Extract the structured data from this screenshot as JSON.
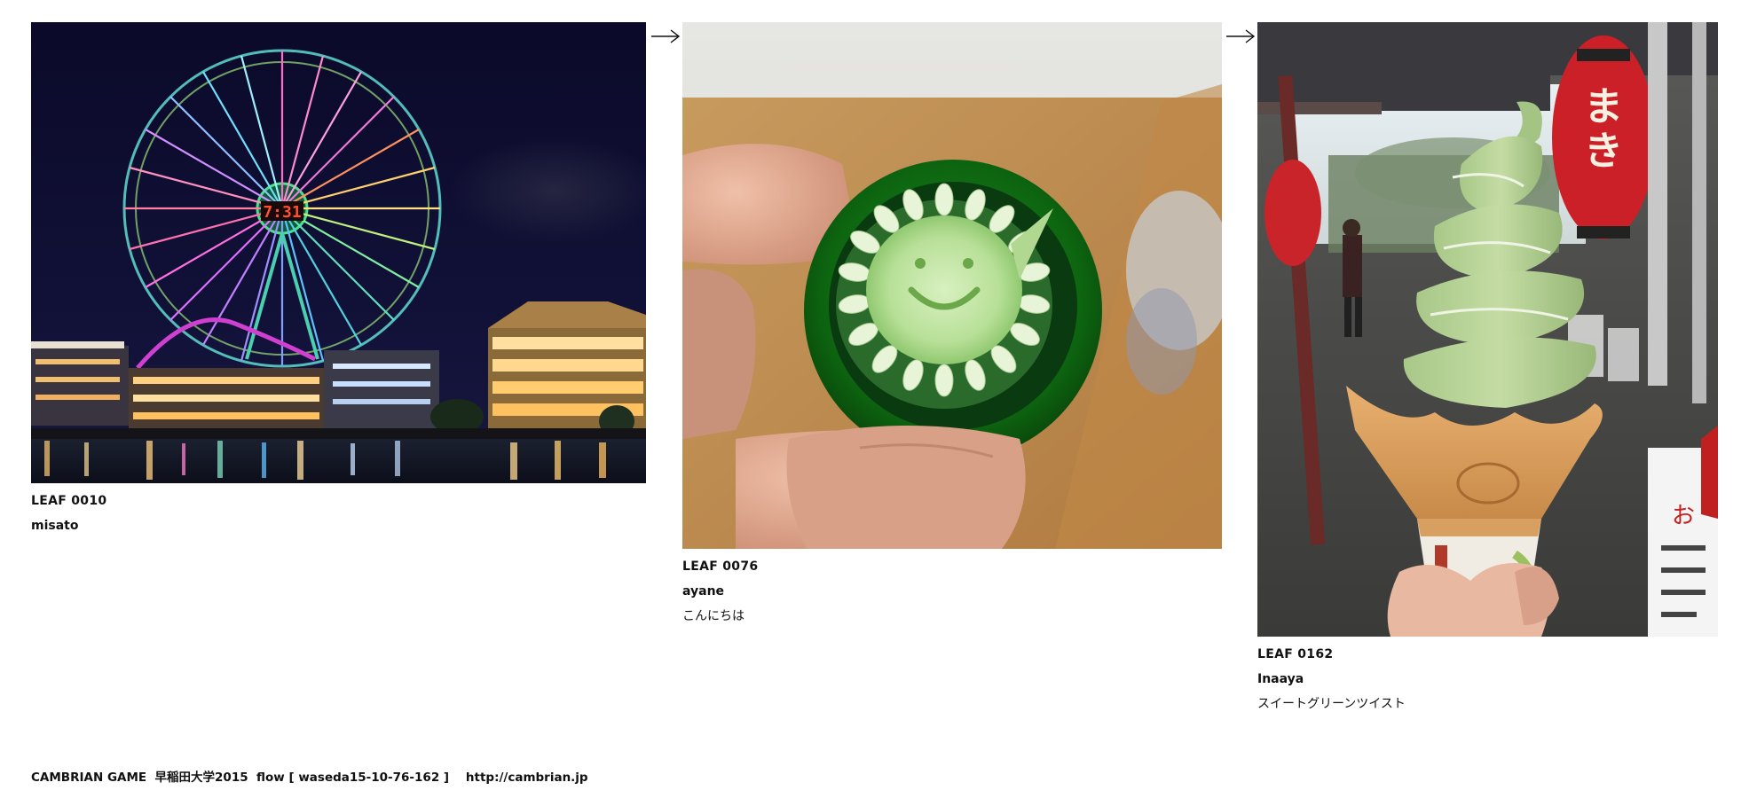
{
  "leaves": [
    {
      "id": "LEAF 0010",
      "author": "misato",
      "caption": "",
      "photo_icon": "ferris-wheel-night-photo"
    },
    {
      "id": "LEAF 0076",
      "author": "ayane",
      "caption": "こんにちは",
      "photo_icon": "green-pepper-smiley-photo"
    },
    {
      "id": "LEAF 0162",
      "author": "Inaaya",
      "caption": "スイートグリーンツイスト",
      "photo_icon": "matcha-soft-serve-photo"
    }
  ],
  "arrow_icon": "right-arrow-icon",
  "footer": {
    "text": "CAMBRIAN GAME  早稲田大学2015  flow [ waseda15-10-76-162 ]    ",
    "link": "http://cambrian.jp"
  },
  "colors": {
    "background": "#ffffff",
    "text": "#111111"
  }
}
